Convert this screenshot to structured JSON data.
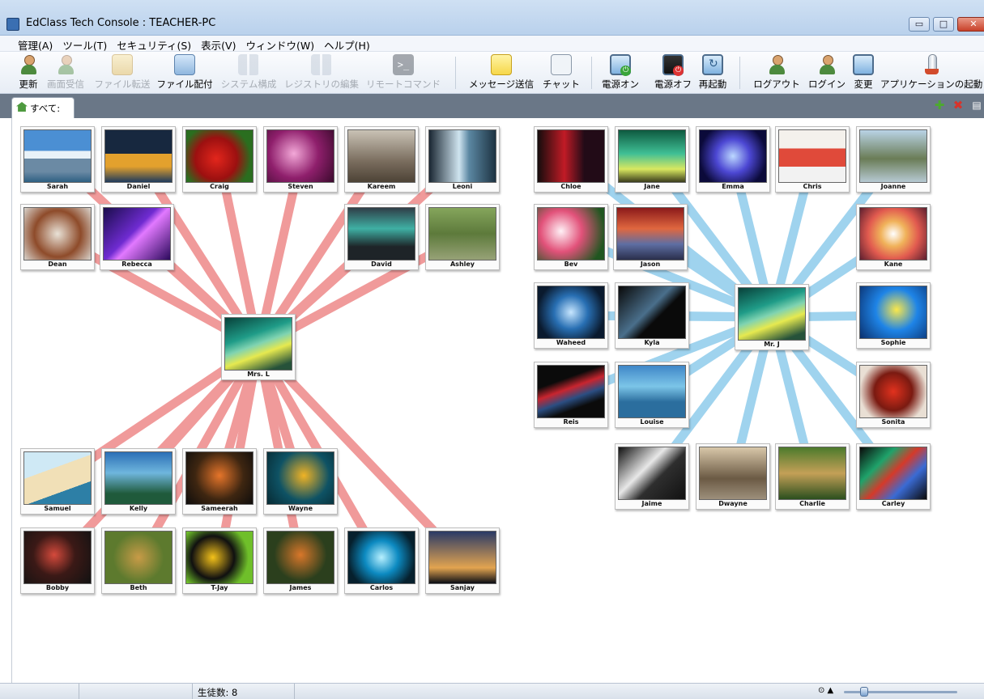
{
  "window": {
    "title": "EdClass Tech Console : TEACHER-PC",
    "min": "▭",
    "max": "□",
    "close": "✕"
  },
  "menu": [
    "管理(A)",
    "ツール(T)",
    "セキュリティ(S)",
    "表示(V)",
    "ウィンドウ(W)",
    "ヘルプ(H)"
  ],
  "toolbar": [
    {
      "label": "更新",
      "icon": "refresh-user-icon",
      "enabled": true
    },
    {
      "label": "画面受信",
      "icon": "receive-screen-icon",
      "enabled": false
    },
    {
      "label": "ファイル転送",
      "icon": "file-transfer-icon",
      "enabled": false
    },
    {
      "label": "ファイル配付",
      "icon": "file-distribute-icon",
      "enabled": true
    },
    {
      "label": "システム構成",
      "icon": "system-config-icon",
      "enabled": false
    },
    {
      "label": "レジストリの編集",
      "icon": "registry-edit-icon",
      "enabled": false
    },
    {
      "label": "リモートコマンド",
      "icon": "remote-command-icon",
      "enabled": false
    },
    {
      "label": "メッセージ送信",
      "icon": "message-send-icon",
      "enabled": true
    },
    {
      "label": "チャット",
      "icon": "chat-icon",
      "enabled": true
    },
    {
      "label": "電源オン",
      "icon": "power-on-icon",
      "enabled": true
    },
    {
      "label": "電源オフ",
      "icon": "power-off-icon",
      "enabled": true
    },
    {
      "label": "再起動",
      "icon": "restart-icon",
      "enabled": true
    },
    {
      "label": "ログアウト",
      "icon": "logout-icon",
      "enabled": true
    },
    {
      "label": "ログイン",
      "icon": "login-icon",
      "enabled": true
    },
    {
      "label": "変更",
      "icon": "change-icon",
      "enabled": true
    },
    {
      "label": "アプリケーションの起動",
      "icon": "launch-app-icon",
      "enabled": true
    }
  ],
  "tab": {
    "label": "すべて:"
  },
  "strip_buttons": {
    "add": "✚",
    "remove": "✖",
    "view": "▤"
  },
  "groups": [
    {
      "teacher": "Mrs. L",
      "line_color": "#f09a9a",
      "students": [
        "Sarah",
        "Daniel",
        "Craig",
        "Steven",
        "Kareem",
        "Leoni",
        "Dean",
        "Rebecca",
        "David",
        "Ashley",
        "Samuel",
        "Kelly",
        "Sameerah",
        "Wayne",
        "Bobby",
        "Beth",
        "T-Jay",
        "James",
        "Carlos",
        "Sanjay"
      ]
    },
    {
      "teacher": "Mr. J",
      "line_color": "#9fd3ee",
      "students": [
        "Chloe",
        "Jane",
        "Emma",
        "Chris",
        "Joanne",
        "Bev",
        "Jason",
        "Kane",
        "Waheed",
        "Kyla",
        "Sophie",
        "Reis",
        "Louise",
        "Sonita",
        "Jaime",
        "Dwayne",
        "Charlie",
        "Carley"
      ]
    }
  ],
  "status": {
    "student_count": "生徒数: 8",
    "zoom_icons": "⊙ ▲"
  }
}
